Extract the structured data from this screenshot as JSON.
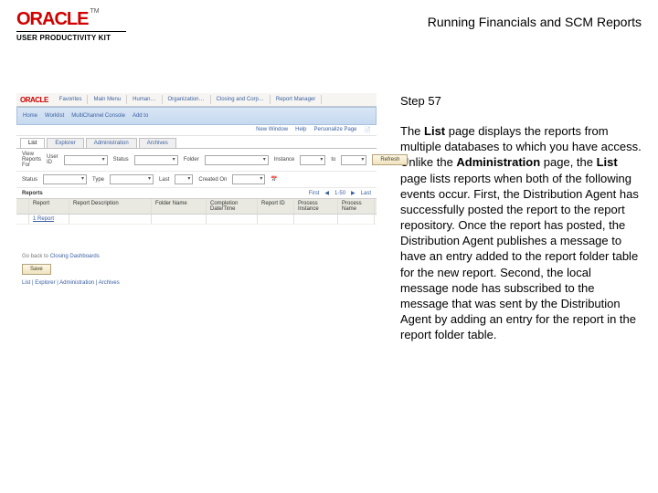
{
  "brand": {
    "name": "ORACLE",
    "tm": "TM",
    "product": "USER PRODUCTIVITY KIT"
  },
  "title": "Running Financials and SCM Reports",
  "step_label": "Step 57",
  "body": {
    "p1a": "The ",
    "p1b": "List",
    "p1c": " page displays the reports from multiple databases to which you have access. Unlike the ",
    "p1d": "Administration",
    "p1e": " page, the ",
    "p1f": "List",
    "p1g": " page lists reports when both of the following events occur. First, the Distribution Agent has successfully posted the report to the report repository. Once the report has posted, the Distribution Agent publishes a message to have an entry added to the report folder table for the new report. Second, the local message node has subscribed to the message that was sent by the Distribution Agent by adding an entry for the report in the report folder table."
  },
  "screenshot": {
    "logo": "ORACLE",
    "top_tabs": [
      "Favorites",
      "Main Menu",
      "Human…",
      "Organization…",
      "Closing and Corp…",
      "Report Manager"
    ],
    "top_right": [
      "Home",
      "Worklist",
      "MultiChannel Console",
      "Add to"
    ],
    "subrow": [
      "New Window",
      "Help",
      "Personalize Page"
    ],
    "tabs2": [
      "List",
      "Explorer",
      "Administration",
      "Archives"
    ],
    "form": {
      "view_label": "View Reports For",
      "user_label": "User ID",
      "user_value": "",
      "status_label": "Status",
      "type_label": "Type",
      "last_label": "Last",
      "folder_label": "Folder",
      "instance_label": "Instance",
      "to_label": "to",
      "refresh": "Refresh",
      "created_on": "Created On"
    },
    "mid": {
      "first": "First",
      "range": "1-50",
      "last": "Last"
    },
    "table": {
      "headers": [
        "",
        "Report",
        "Report Description",
        "Folder Name",
        "Completion Date/Time",
        "Report ID",
        "Process Instance",
        "Process Name"
      ],
      "row1": {
        "id": "1 Report"
      }
    },
    "lowlinks": {
      "go": "Go back to",
      "target": "Closing Dashboards"
    },
    "save": "Save",
    "bottom_tabs": "List | Explorer | Administration | Archives"
  }
}
